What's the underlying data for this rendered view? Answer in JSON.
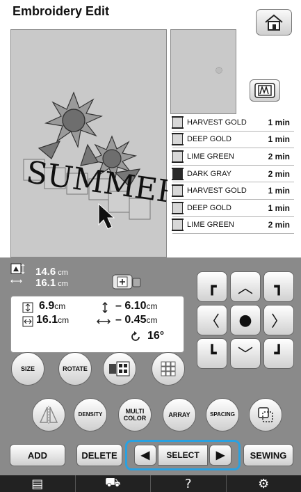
{
  "header": {
    "title": "Embroidery Edit"
  },
  "canvas": {
    "text": "SUMMER"
  },
  "threads": [
    {
      "name": "HARVEST GOLD",
      "time": "1 min",
      "color": "#d8d8d8"
    },
    {
      "name": "DEEP GOLD",
      "time": "1 min",
      "color": "#d8d8d8"
    },
    {
      "name": "LIME GREEN",
      "time": "2 min",
      "color": "#d8d8d8"
    },
    {
      "name": "DARK GRAY",
      "time": "2 min",
      "color": "#2a2a2a"
    },
    {
      "name": "HARVEST GOLD",
      "time": "1 min",
      "color": "#d8d8d8"
    },
    {
      "name": "DEEP GOLD",
      "time": "1 min",
      "color": "#d8d8d8"
    },
    {
      "name": "LIME GREEN",
      "time": "2 min",
      "color": "#d8d8d8"
    }
  ],
  "size": {
    "height": "14.6",
    "width": "16.1",
    "unit": "cm"
  },
  "info": {
    "height": "6.9",
    "width": "16.1",
    "unit": "cm",
    "vertical_offset": "– 6.10",
    "horizontal_offset": "– 0.45",
    "rotation": "16°"
  },
  "buttons": {
    "size": "SIZE",
    "rotate": "ROTATE",
    "density": "DENSITY",
    "multi_color": "MULTI\nCOLOR",
    "array": "ARRAY",
    "spacing": "SPACING",
    "add": "ADD",
    "delete": "DELETE",
    "select": "SELECT",
    "sewing": "SEWING"
  },
  "colors": {
    "highlight": "#2aa1e0",
    "panel": "#8a8a8a",
    "canvas": "#c9c9c9"
  }
}
